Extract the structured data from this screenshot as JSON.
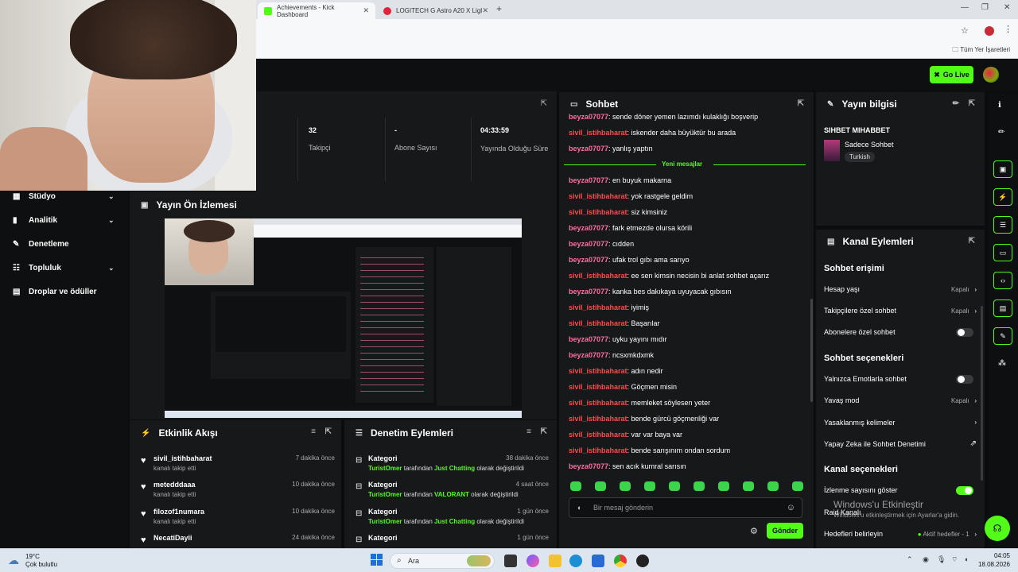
{
  "browser": {
    "tabs": [
      {
        "label": "Achievements - Kick Dashboard",
        "active": true,
        "favicon_color": "#53fc18"
      },
      {
        "label": "LOGITECH G Astro A20 X Lightsp",
        "active": false,
        "favicon_color": "#e2233b"
      }
    ],
    "bookmarks_label": "Tüm Yer İşaretleri"
  },
  "header": {
    "go_live": "Go Live"
  },
  "stats": [
    {
      "value": "32",
      "label": "Takipçi"
    },
    {
      "value": "-",
      "label": "Abone Sayısı"
    },
    {
      "value": "04:33:59",
      "label": "Yayında Olduğu Süre"
    }
  ],
  "sidebar": {
    "items": [
      {
        "label": "Stüdyo",
        "icon": "studio-icon",
        "chevron": true
      },
      {
        "label": "Analitik",
        "icon": "analytics-icon",
        "chevron": true
      },
      {
        "label": "Denetleme",
        "icon": "wrench-icon",
        "chevron": false
      },
      {
        "label": "Topluluk",
        "icon": "community-icon",
        "chevron": true
      },
      {
        "label": "Droplar ve ödüller",
        "icon": "drops-icon",
        "chevron": false
      }
    ]
  },
  "preview": {
    "title": "Yayın Ön İzlemesi"
  },
  "activity": {
    "title": "Etkinlik Akışı",
    "items": [
      {
        "name": "sivil_istihbaharat",
        "sub": "kanalı takip etti",
        "time": "7 dakika önce"
      },
      {
        "name": "metedddaaa",
        "sub": "kanalı takip etti",
        "time": "10 dakika önce"
      },
      {
        "name": "filozof1numara",
        "sub": "kanalı takip etti",
        "time": "10 dakika önce"
      },
      {
        "name": "NecatiDayii",
        "sub": "",
        "time": "24 dakika önce"
      }
    ]
  },
  "audit": {
    "title": "Denetim Eylemleri",
    "items": [
      {
        "title": "Kategori",
        "user": "TuristOmer",
        "mid": "tarafından",
        "cat": "Just Chatting",
        "tail": "olarak değiştirildi",
        "time": "38 dakika önce"
      },
      {
        "title": "Kategori",
        "user": "TuristOmer",
        "mid": "tarafından",
        "cat": "VALORANT",
        "tail": "olarak değiştirildi",
        "time": "4 saat önce"
      },
      {
        "title": "Kategori",
        "user": "TuristOmer",
        "mid": "tarafından",
        "cat": "Just Chatting",
        "tail": "olarak değiştirildi",
        "time": "1 gün önce"
      },
      {
        "title": "Kategori",
        "user": "",
        "mid": "",
        "cat": "",
        "tail": "",
        "time": "1 gün önce"
      }
    ]
  },
  "chat": {
    "title": "Sohbet",
    "new_messages": "Yeni mesajlar",
    "input_placeholder": "Bir mesaj gönderin",
    "send": "Gönder",
    "before": [
      {
        "user": "beyza07077",
        "cls": "u1",
        "text": ": sende döner yemen lazımdı kulaklığı boşverip"
      },
      {
        "user": "sivil_istihbaharat",
        "cls": "u2",
        "text": ": iskender daha büyüktür bu arada"
      },
      {
        "user": "beyza07077",
        "cls": "u1",
        "text": ": yanlış yaptın"
      }
    ],
    "after": [
      {
        "user": "beyza07077",
        "cls": "u1",
        "text": ": en buyuk makarna"
      },
      {
        "user": "sivil_istihbaharat",
        "cls": "u2",
        "text": ": yok rastgele geldim"
      },
      {
        "user": "sivil_istihbaharat",
        "cls": "u2",
        "text": ": siz kimsiniz"
      },
      {
        "user": "beyza07077",
        "cls": "u1",
        "text": ": fark etmezde olursa körili"
      },
      {
        "user": "beyza07077",
        "cls": "u1",
        "text": ": cıdden"
      },
      {
        "user": "beyza07077",
        "cls": "u1",
        "text": ": ufak trol gıbı ama sarıyo"
      },
      {
        "user": "sivil_istihbaharat",
        "cls": "u2",
        "text": ": ee sen kimsin necisin bi anlat sohbet açarız"
      },
      {
        "user": "beyza07077",
        "cls": "u1",
        "text": ": kanka bes dakıkaya uyuyacak gıbısın"
      },
      {
        "user": "sivil_istihbaharat",
        "cls": "u2",
        "text": ": iyimiş"
      },
      {
        "user": "sivil_istihbaharat",
        "cls": "u2",
        "text": ": Başarılar"
      },
      {
        "user": "beyza07077",
        "cls": "u1",
        "text": ": uyku yayını mıdır"
      },
      {
        "user": "beyza07077",
        "cls": "u1",
        "text": ": ncsxmkdxmk"
      },
      {
        "user": "sivil_istihbaharat",
        "cls": "u2",
        "text": ": adın nedir"
      },
      {
        "user": "sivil_istihbaharat",
        "cls": "u2",
        "text": ": Göçmen misin"
      },
      {
        "user": "sivil_istihbaharat",
        "cls": "u2",
        "text": ": memleket söylesen yeter"
      },
      {
        "user": "sivil_istihbaharat",
        "cls": "u2",
        "text": ": bende gürcü göçmenliği var"
      },
      {
        "user": "sivil_istihbaharat",
        "cls": "u2",
        "text": ": var var baya var"
      },
      {
        "user": "sivil_istihbaharat",
        "cls": "u2",
        "text": ": bende sarışınım ondan sordum"
      },
      {
        "user": "beyza07077",
        "cls": "u1",
        "text": ": sen acık kumral sarısın"
      }
    ]
  },
  "stream_info": {
    "title": "Yayın bilgisi",
    "stream_title": "SIHBET MIHABBET",
    "category": "Sadece Sohbet",
    "language": "Turkish"
  },
  "channel_actions": {
    "title": "Kanal Eylemleri",
    "chat_access": "Sohbet erişimi",
    "account_age": "Hesap yaşı",
    "account_age_val": "Kapalı",
    "followers_only": "Takipçilere özel sohbet",
    "followers_only_val": "Kapalı",
    "subs_only": "Abonelere özel sohbet",
    "chat_options": "Sohbet seçenekleri",
    "emotes_only": "Yalnızca Emotlarla sohbet",
    "slow_mode": "Yavaş mod",
    "slow_mode_val": "Kapalı",
    "banned_words": "Yasaklanmış kelimeler",
    "ai_mod": "Yapay Zeka ile Sohbet Denetimi",
    "channel_options": "Kanal seçenekleri",
    "show_viewers": "İzlenme sayısını göster",
    "raid": "Raid Kanalı",
    "goals": "Hedefleri belirleyin",
    "goals_val": "Aktif hedefler - 1"
  },
  "watermark": {
    "line1": "Windows'u Etkinleştir",
    "line2": "Windows'u etkinleştirmek için Ayarlar'a gidin."
  },
  "taskbar": {
    "weather_temp": "19°C",
    "weather_desc": "Çok bulutlu",
    "search": "Ara",
    "time": "04:05",
    "date": "18.08.2026"
  },
  "colors": {
    "accent": "#53fc18",
    "panel": "#17181a",
    "bg": "#0b0c0d"
  }
}
